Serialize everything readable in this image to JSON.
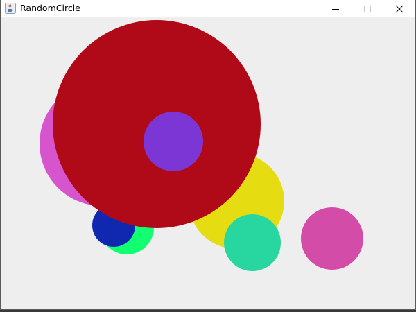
{
  "window": {
    "title": "RandomCircle",
    "app_icon": "java-cup-icon",
    "controls": {
      "minimize_icon": "minimize-icon",
      "maximize_icon": "maximize-icon",
      "close_icon": "close-icon"
    }
  },
  "canvas": {
    "background_color": "#eeeeee",
    "circle_colors": [
      "#d655cc",
      "#b00a18",
      "#7d36d6",
      "#e6dc12",
      "#11ff70",
      "#1028b0",
      "#28d6a0",
      "#d24ca8"
    ]
  }
}
